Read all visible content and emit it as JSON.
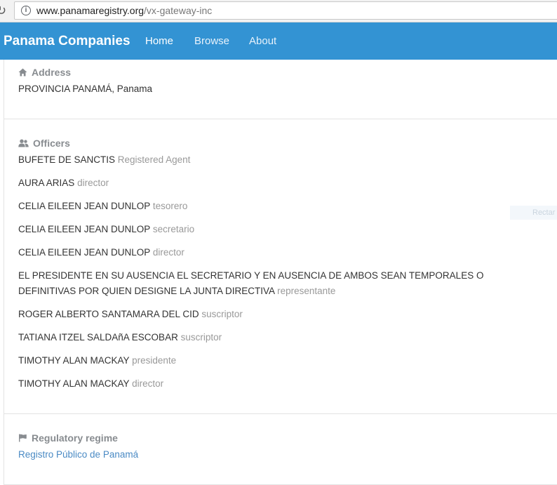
{
  "browser": {
    "url_domain": "www.panamaregistry.org",
    "url_path": "/vx-gateway-inc"
  },
  "navbar": {
    "brand": "Panama Companies",
    "links": [
      "Home",
      "Browse",
      "About"
    ]
  },
  "address": {
    "heading": "Address",
    "value": "PROVINCIA PANAMÁ, Panama"
  },
  "officers": {
    "heading": "Officers",
    "items": [
      {
        "name": "BUFETE DE SANCTIS",
        "role": "Registered Agent"
      },
      {
        "name": "AURA ARIAS",
        "role": "director"
      },
      {
        "name": "CELIA EILEEN JEAN DUNLOP",
        "role": "tesorero"
      },
      {
        "name": "CELIA EILEEN JEAN DUNLOP",
        "role": "secretario"
      },
      {
        "name": "CELIA EILEEN JEAN DUNLOP",
        "role": "director"
      },
      {
        "name": "EL PRESIDENTE EN SU AUSENCIA EL SECRETARIO Y EN AUSENCIA DE AMBOS SEAN TEMPORALES O DEFINITIVAS POR QUIEN DESIGNE LA JUNTA DIRECTIVA",
        "role": "representante"
      },
      {
        "name": "ROGER ALBERTO SANTAMARA DEL CID",
        "role": "suscriptor"
      },
      {
        "name": "TATIANA ITZEL SALDAñA ESCOBAR",
        "role": "suscriptor"
      },
      {
        "name": "TIMOTHY ALAN MACKAY",
        "role": "presidente"
      },
      {
        "name": "TIMOTHY ALAN MACKAY",
        "role": "director"
      }
    ]
  },
  "regulatory": {
    "heading": "Regulatory regime",
    "value": "Registro Público de Panamá"
  },
  "ghost_label": "Rectar",
  "colors": {
    "navbar": "#3393d3",
    "heading": "#888c90",
    "role": "#999999",
    "link": "#4a8ac4"
  }
}
